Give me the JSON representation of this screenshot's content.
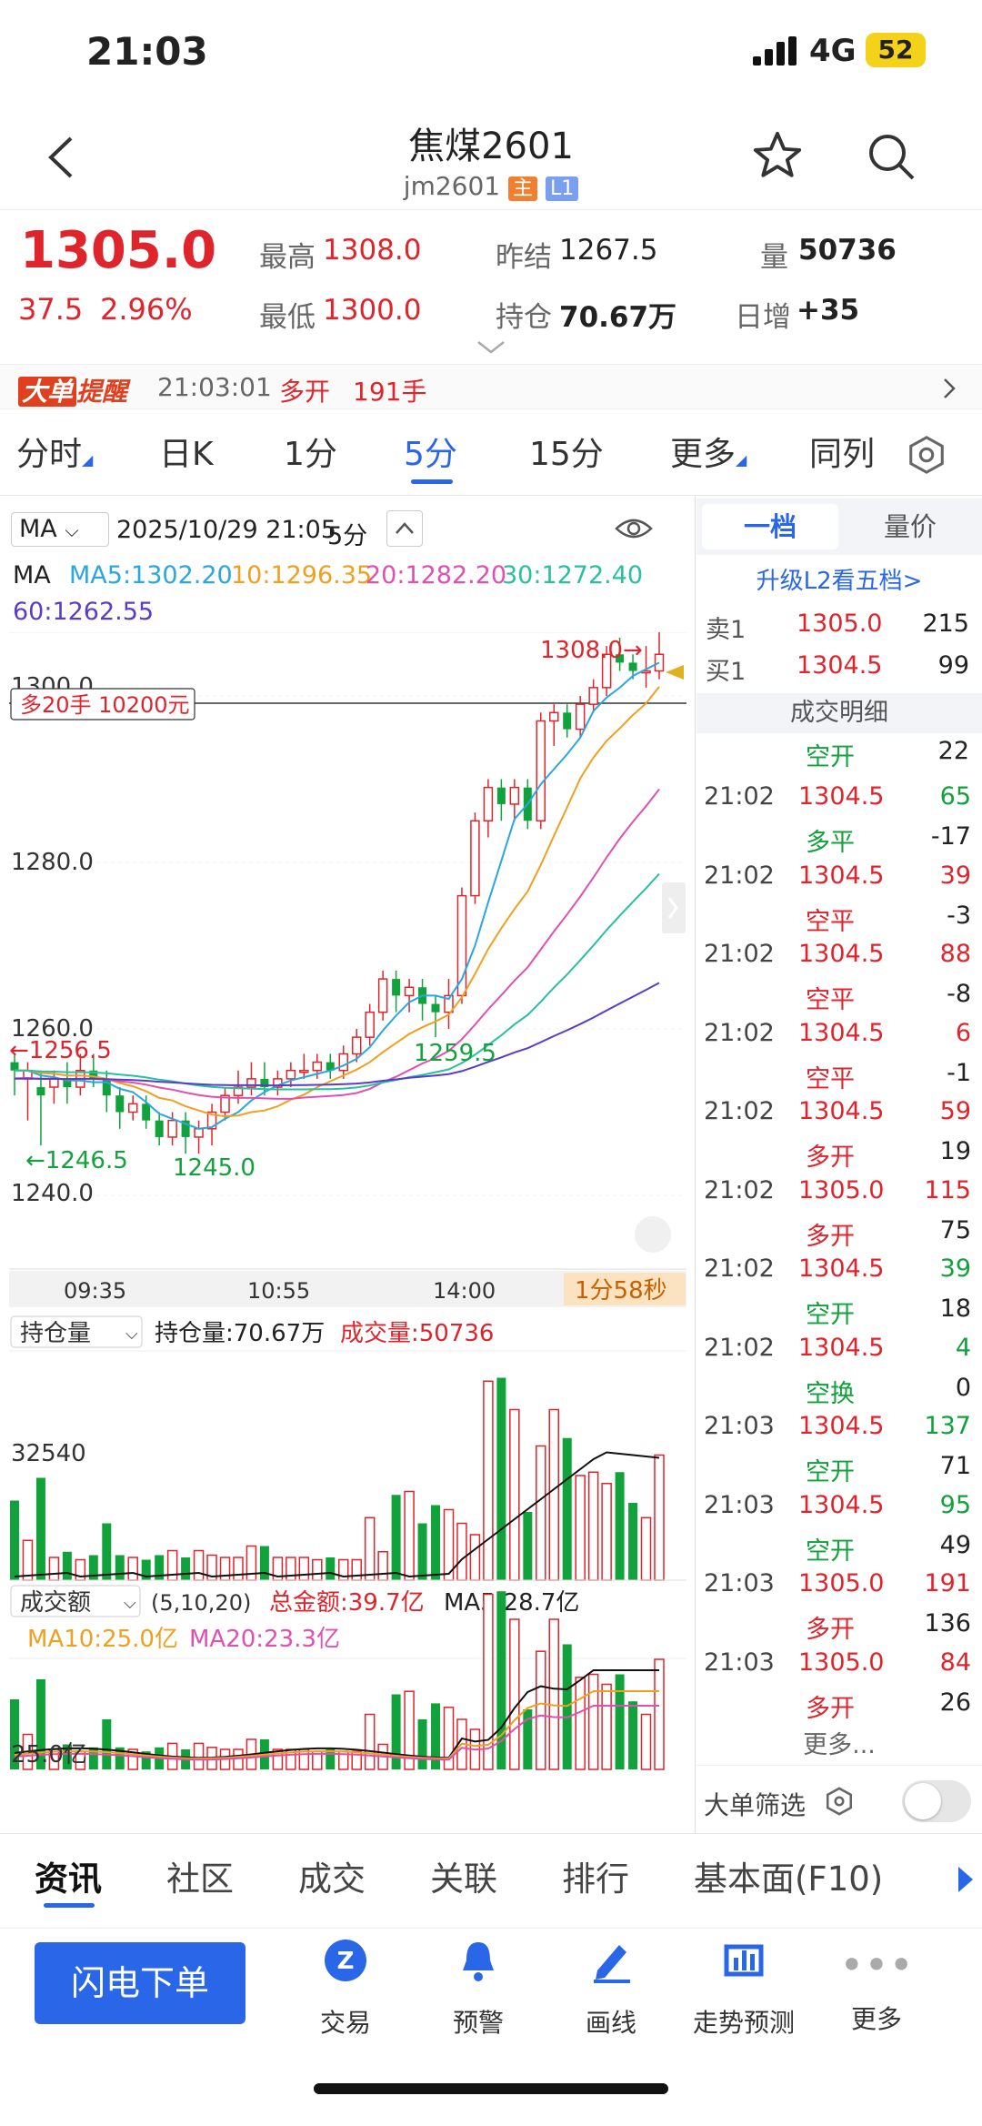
{
  "status": {
    "time": "21:03",
    "network": "4G",
    "battery": "52"
  },
  "nav": {
    "title": "焦煤2601",
    "code": "jm2601",
    "badge_main": "主",
    "badge_level": "L1"
  },
  "quote": {
    "price": "1305.0",
    "change": "37.5",
    "change_pct": "2.96%",
    "high_label": "最高",
    "high": "1308.0",
    "low_label": "最低",
    "low": "1300.0",
    "prev_label": "昨结",
    "prev": "1267.5",
    "oi_label": "持仓",
    "oi": "70.67万",
    "vol_label": "量",
    "vol": "50736",
    "daily_inc_label": "日增",
    "daily_inc": "+35"
  },
  "alert": {
    "tag1": "大单",
    "tag2": "提醒",
    "time": "21:03:01",
    "action": "多开",
    "qty": "191手"
  },
  "tabs": [
    "分时",
    "日K",
    "1分",
    "5分",
    "15分",
    "更多",
    "同列"
  ],
  "chart_header": {
    "indicator": "MA",
    "datetime": "2025/10/29 21:05",
    "period": "5分"
  },
  "ma_legend": {
    "label": "MA",
    "ma5": "MA5:1302.20",
    "ma10": "10:1296.35",
    "ma20": "20:1282.20",
    "ma30": "30:1272.40",
    "ma60": "60:1262.55"
  },
  "price_axis": {
    "p1300": "1300.0",
    "p1280": "1280.0",
    "p1260": "1260.0",
    "p1240": "1240.0"
  },
  "annotations": {
    "high": "1308.0→",
    "left_high": "←1256.5",
    "left_low": "←1246.5",
    "low": "1245.0",
    "mid": "1259.5",
    "position_box": "多20手 10200元"
  },
  "time_axis": {
    "t1": "09:35",
    "t2": "10:55",
    "t3": "14:00",
    "countdown": "1分58秒"
  },
  "oi_panel": {
    "selector": "持仓量",
    "oi_text": "持仓量:70.67万",
    "vol_text": "成交量:50736",
    "axis": "32540"
  },
  "amount_panel": {
    "selector": "成交额",
    "params": "(5,10,20)",
    "total": "总金额:39.7亿",
    "ma5": "MA5:28.7亿",
    "ma10": "MA10:25.0亿",
    "ma20": "MA20:23.3亿",
    "axis": "25.0亿"
  },
  "colors": {
    "up": "#e0242c",
    "down": "#12a23c",
    "accent": "#2a66e8",
    "ma5": "#2aa6e0",
    "ma10": "#f0a020",
    "ma20": "#e050b0",
    "ma30": "#28c0a0",
    "ma60": "#5a3cc8"
  },
  "right": {
    "tab1": "一档",
    "tab2": "量价",
    "upgrade": "升级L2看五档>",
    "sell_label": "卖1",
    "sell_price": "1305.0",
    "sell_qty": "215",
    "buy_label": "买1",
    "buy_price": "1304.5",
    "buy_qty": "99",
    "detail_title": "成交明细",
    "more": "更多...",
    "filter": "大单筛选",
    "first": {
      "type": "空开",
      "qty": "22"
    },
    "trades": [
      {
        "time": "21:02",
        "price": "1304.5",
        "vol": "65",
        "type": "多平",
        "oi": "-17"
      },
      {
        "time": "21:02",
        "price": "1304.5",
        "vol": "39",
        "type": "空平",
        "oi": "-3"
      },
      {
        "time": "21:02",
        "price": "1304.5",
        "vol": "88",
        "type": "空平",
        "oi": "-8"
      },
      {
        "time": "21:02",
        "price": "1304.5",
        "vol": "6",
        "type": "空平",
        "oi": "-1"
      },
      {
        "time": "21:02",
        "price": "1304.5",
        "vol": "59",
        "type": "多开",
        "oi": "19"
      },
      {
        "time": "21:02",
        "price": "1305.0",
        "vol": "115",
        "type": "多开",
        "oi": "75"
      },
      {
        "time": "21:02",
        "price": "1304.5",
        "vol": "39",
        "type": "空开",
        "oi": "18"
      },
      {
        "time": "21:02",
        "price": "1304.5",
        "vol": "4",
        "type": "空换",
        "oi": "0"
      },
      {
        "time": "21:03",
        "price": "1304.5",
        "vol": "137",
        "type": "空开",
        "oi": "71"
      },
      {
        "time": "21:03",
        "price": "1304.5",
        "vol": "95",
        "type": "空开",
        "oi": "49"
      },
      {
        "time": "21:03",
        "price": "1305.0",
        "vol": "191",
        "type": "多开",
        "oi": "136"
      },
      {
        "time": "21:03",
        "price": "1305.0",
        "vol": "84",
        "type": "多开",
        "oi": "26"
      }
    ]
  },
  "bottom_tabs": [
    "资讯",
    "社区",
    "成交",
    "关联",
    "排行",
    "基本面(F10)"
  ],
  "toolbar": {
    "flash_order": "闪电下单",
    "trade": "交易",
    "alert": "预警",
    "draw": "画线",
    "trend": "走势预测",
    "more": "更多"
  }
}
